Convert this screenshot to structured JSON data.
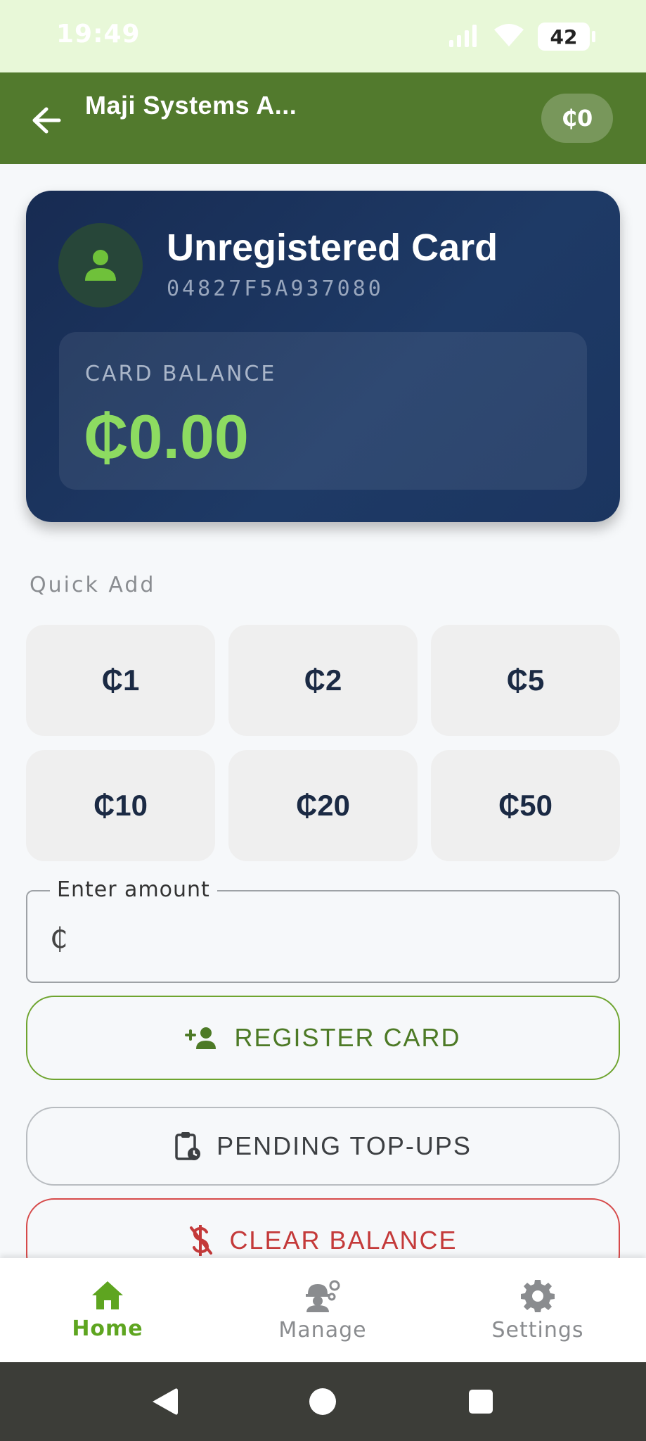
{
  "status_bar": {
    "time": "19:49",
    "battery": "42"
  },
  "app_bar": {
    "title": "Maji Systems A...",
    "balance_pill": "₵0"
  },
  "card": {
    "title": "Unregistered Card",
    "card_id": "04827F5A937080",
    "balance_label": "CARD BALANCE",
    "balance_value": "₵0.00"
  },
  "quick_add": {
    "label": "Quick Add",
    "amounts": [
      "₵1",
      "₵2",
      "₵5",
      "₵10",
      "₵20",
      "₵50"
    ]
  },
  "amount_field": {
    "label": "Enter amount",
    "prefix": "₵",
    "value": ""
  },
  "actions": {
    "register": "REGISTER CARD",
    "pending": "PENDING TOP-UPS",
    "clear": "CLEAR BALANCE"
  },
  "bottom_nav": {
    "items": [
      {
        "label": "Home",
        "icon": "home-icon",
        "active": true
      },
      {
        "label": "Manage",
        "icon": "worker-gears-icon",
        "active": false
      },
      {
        "label": "Settings",
        "icon": "gear-icon",
        "active": false
      }
    ]
  },
  "colors": {
    "app_bar": "#527a2d",
    "accent_green": "#8ddb61",
    "card_bg": "#1e3a66",
    "danger": "#c43a3a"
  }
}
